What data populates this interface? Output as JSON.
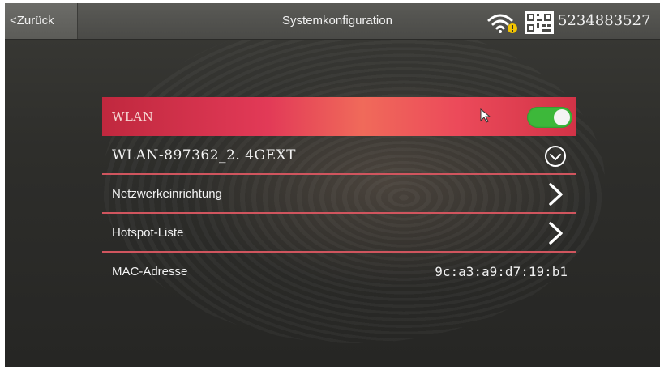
{
  "header": {
    "back_label": "<Zurück",
    "title": "Systemkonfiguration",
    "device_id": "5234883527",
    "status_icons": [
      "wifi-warning-icon",
      "qr-code-icon"
    ]
  },
  "menu": {
    "items": [
      {
        "label": "WLAN",
        "control": "toggle",
        "state": "on"
      },
      {
        "label": "WLAN-897362_2. 4GEXT",
        "control": "check-icon"
      },
      {
        "label": "Netzwerkeinrichtung",
        "control": "chevron-right-icon"
      },
      {
        "label": "Hotspot-Liste",
        "control": "chevron-right-icon"
      },
      {
        "label": "MAC-Adresse",
        "value": "9c:a3:a9:d7:19:b1"
      }
    ]
  },
  "colors": {
    "highlight": "#e23a57",
    "toggle_on": "#3db83a",
    "divider": "#d0555e",
    "topbar": "#4a4a47"
  }
}
